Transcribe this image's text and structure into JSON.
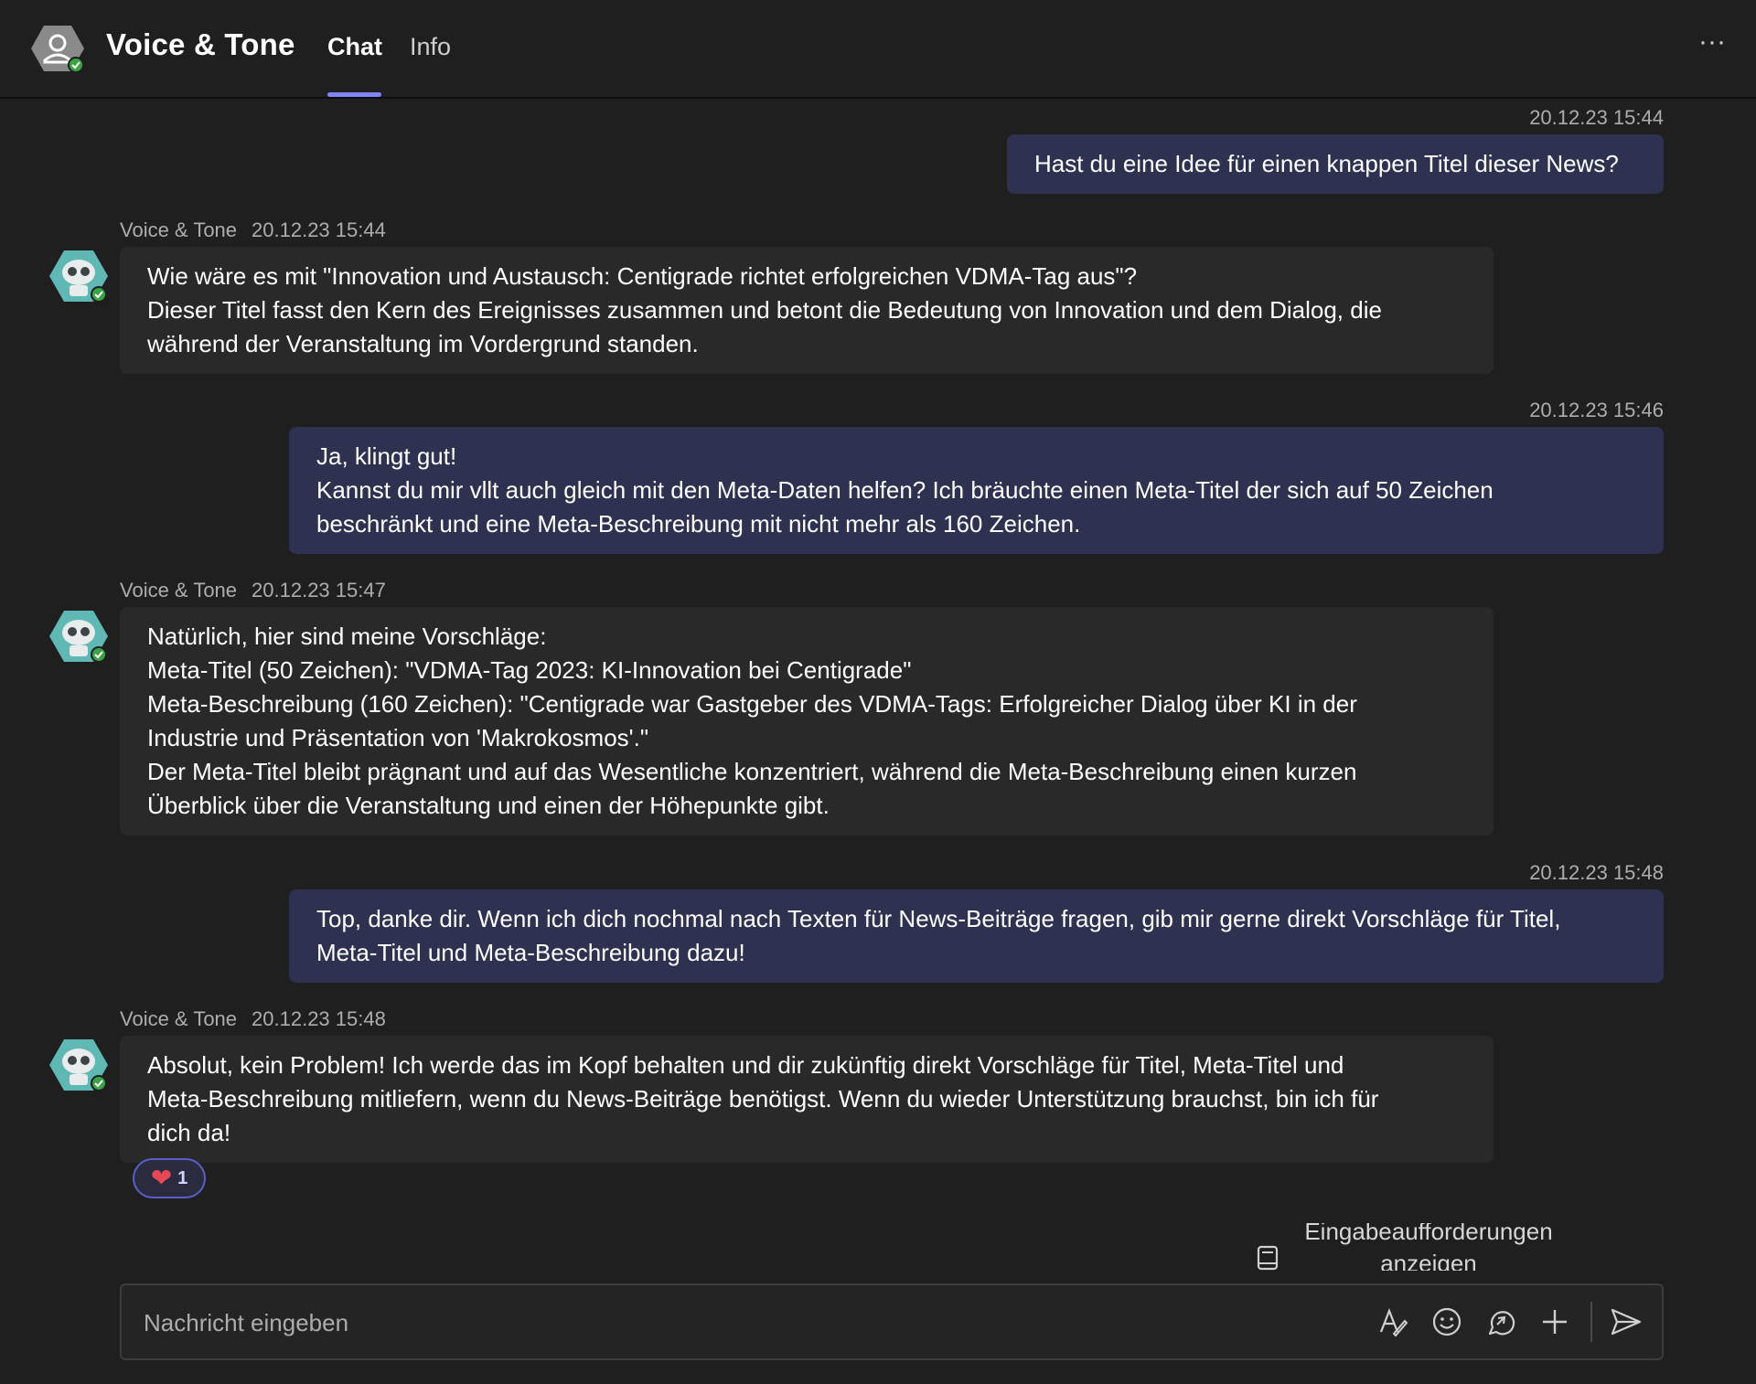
{
  "header": {
    "title": "Voice & Tone",
    "tabs": [
      {
        "label": "Chat",
        "active": true
      },
      {
        "label": "Info",
        "active": false
      }
    ],
    "more_label": "···"
  },
  "colors": {
    "background": "#1f1f1f",
    "outgoing_bubble": "#2f3150",
    "incoming_bubble": "#292929",
    "accent": "#7f85f5",
    "status_green": "#3aa346",
    "heart": "#e74856"
  },
  "messages": [
    {
      "direction": "out",
      "timestamp": "20.12.23 15:44",
      "lines": [
        "Hast du eine Idee für einen knappen Titel dieser News?"
      ]
    },
    {
      "direction": "in",
      "sender": "Voice & Tone",
      "timestamp": "20.12.23 15:44",
      "lines": [
        "Wie wäre es mit \"Innovation und Austausch: Centigrade richtet erfolgreichen VDMA-Tag aus\"?",
        "Dieser Titel fasst den Kern des Ereignisses zusammen und betont die Bedeutung von Innovation und dem Dialog, die",
        "während der Veranstaltung im Vordergrund standen."
      ]
    },
    {
      "direction": "out",
      "timestamp": "20.12.23 15:46",
      "lines": [
        "Ja, klingt gut!",
        "Kannst du mir vllt auch gleich mit den Meta-Daten helfen? Ich bräuchte einen Meta-Titel der sich auf 50 Zeichen",
        "beschränkt und eine Meta-Beschreibung mit nicht mehr als 160 Zeichen."
      ]
    },
    {
      "direction": "in",
      "sender": "Voice & Tone",
      "timestamp": "20.12.23 15:47",
      "lines": [
        "Natürlich, hier sind meine Vorschläge:",
        "Meta-Titel (50 Zeichen): \"VDMA-Tag 2023: KI-Innovation bei Centigrade\"",
        "Meta-Beschreibung (160 Zeichen): \"Centigrade war Gastgeber des VDMA-Tags: Erfolgreicher Dialog über KI in der",
        "Industrie und Präsentation von 'Makrokosmos'.\"",
        "Der Meta-Titel bleibt prägnant und auf das Wesentliche konzentriert, während die Meta-Beschreibung einen kurzen",
        "Überblick über die Veranstaltung und einen der Höhepunkte gibt."
      ]
    },
    {
      "direction": "out",
      "timestamp": "20.12.23 15:48",
      "lines": [
        "Top, danke dir. Wenn ich dich nochmal nach Texten für News-Beiträge fragen, gib mir gerne direkt Vorschläge für Titel,",
        "Meta-Titel und Meta-Beschreibung dazu!"
      ]
    },
    {
      "direction": "in",
      "sender": "Voice & Tone",
      "timestamp": "20.12.23 15:48",
      "lines": [
        "Absolut, kein Problem! Ich werde das im Kopf behalten und dir zukünftig direkt Vorschläge für Titel, Meta-Titel und",
        "Meta-Beschreibung mitliefern, wenn du News-Beiträge benötigst. Wenn du wieder Unterstützung brauchst, bin ich für",
        "dich da!"
      ],
      "reaction": {
        "emoji": "heart",
        "count": "1"
      }
    }
  ],
  "prompts": {
    "label_line1": "Eingabeaufforderungen",
    "label_line2": "anzeigen"
  },
  "composer": {
    "placeholder": "Nachricht eingeben",
    "value": ""
  },
  "icons": [
    "format-icon",
    "emoji-icon",
    "loop-icon",
    "plus-icon",
    "send-icon",
    "prompt-book-icon"
  ]
}
